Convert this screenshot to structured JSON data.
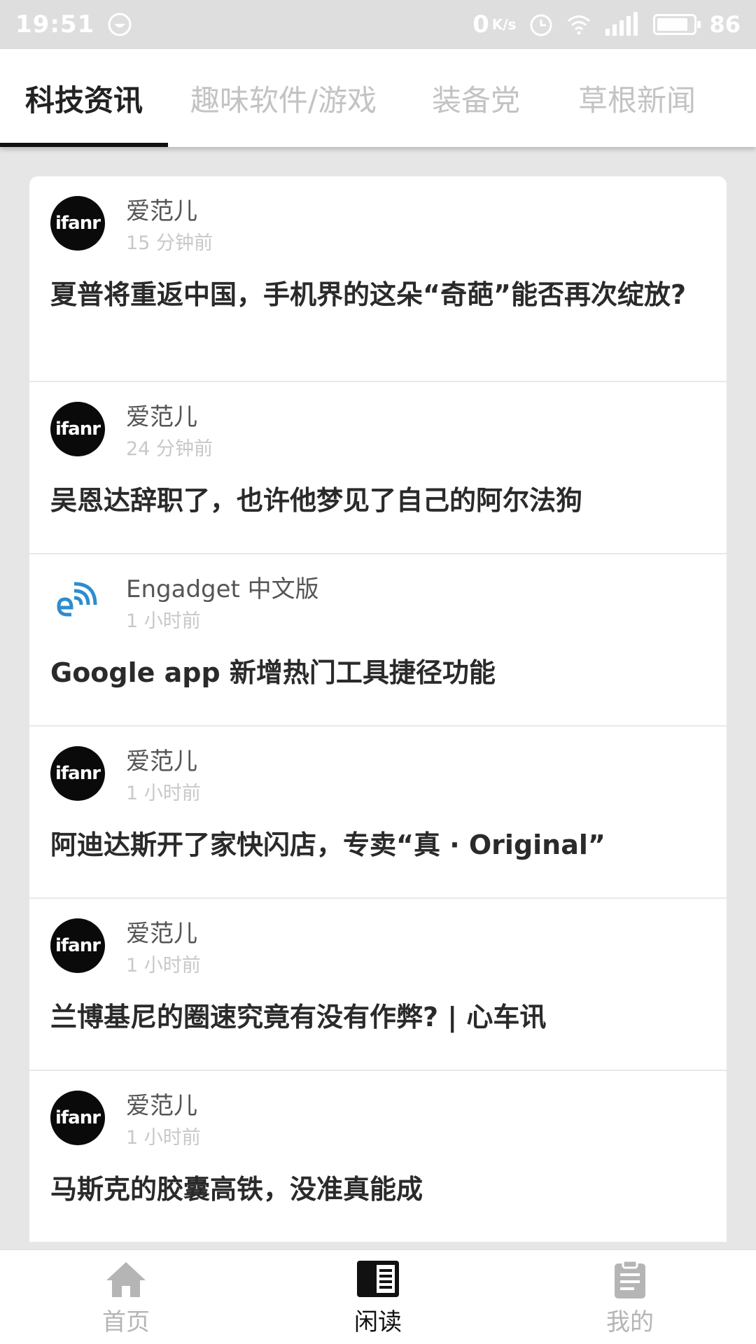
{
  "status_bar": {
    "time": "19:51",
    "speed_value": "0",
    "speed_unit": "K/s",
    "battery": "86",
    "battery_level": 0.86
  },
  "tabs": [
    {
      "label": "科技资讯",
      "active": true
    },
    {
      "label": "趣味软件/游戏",
      "active": false
    },
    {
      "label": "装备党",
      "active": false
    },
    {
      "label": "草根新闻",
      "active": false
    }
  ],
  "feed": [
    {
      "source": "爱范儿",
      "time": "15 分钟前",
      "title": "夏普将重返中国，手机界的这朵“奇葩”能否再次绽放?",
      "avatar": "ifanr"
    },
    {
      "source": "爱范儿",
      "time": "24 分钟前",
      "title": "吴恩达辞职了，也许他梦见了自己的阿尔法狗",
      "avatar": "ifanr"
    },
    {
      "source": "Engadget 中文版",
      "time": "1 小时前",
      "title": "Google app 新增热门工具捷径功能",
      "avatar": "engadget"
    },
    {
      "source": "爱范儿",
      "time": "1 小时前",
      "title": "阿迪达斯开了家快闪店，专卖“真 · Original”",
      "avatar": "ifanr"
    },
    {
      "source": "爱范儿",
      "time": "1 小时前",
      "title": "兰博基尼的圈速究竟有没有作弊? | 心车讯",
      "avatar": "ifanr"
    },
    {
      "source": "爱范儿",
      "time": "1 小时前",
      "title": "马斯克的胶囊高铁，没准真能成",
      "avatar": "ifanr"
    }
  ],
  "avatar_text": {
    "ifanr": "ifanr"
  },
  "bottom_nav": [
    {
      "label": "首页",
      "icon": "home-icon",
      "active": false
    },
    {
      "label": "闲读",
      "icon": "reader-icon",
      "active": true
    },
    {
      "label": "我的",
      "icon": "clipboard-icon",
      "active": false
    }
  ],
  "colors": {
    "accent": "#111111",
    "inactive": "#c3c3c3",
    "engadget_blue": "#2d8ccf"
  }
}
